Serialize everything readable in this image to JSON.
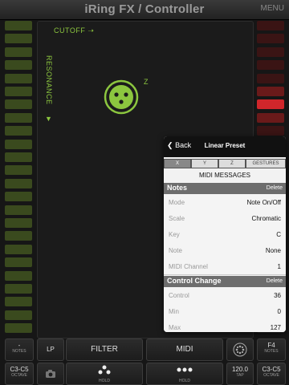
{
  "header": {
    "title": "iRing FX / Controller",
    "menu_label": "MENU"
  },
  "colors": {
    "accent": "#8cc63f",
    "meter_left": "#3a4a1e",
    "meter_right_dim": "#3a1414",
    "meter_right_active": "#d0262b"
  },
  "pad": {
    "x_axis_label": "CUTOFF",
    "y_axis_label": "RESONANCE",
    "z_label": "Z",
    "x_arrow_icon": "arrow-right-icon",
    "y_arrow_icon": "arrow-down-icon"
  },
  "popover": {
    "back_label": "Back",
    "title": "Linear Preset",
    "tabs": [
      "X",
      "Y",
      "Z",
      "GESTURES"
    ],
    "selected_tab": "X",
    "messages_header": "MIDI MESSAGES",
    "notes_section": {
      "title": "Notes",
      "delete_label": "Delete",
      "rows": [
        {
          "label": "Mode",
          "value": "Note On/Off"
        },
        {
          "label": "Scale",
          "value": "Chromatic"
        },
        {
          "label": "Key",
          "value": "C"
        },
        {
          "label": "Note",
          "value": "None"
        },
        {
          "label": "MIDI Channel",
          "value": "1"
        }
      ]
    },
    "cc_section": {
      "title": "Control Change",
      "delete_label": "Delete",
      "rows": [
        {
          "label": "Control",
          "value": "36"
        },
        {
          "label": "Min",
          "value": "0"
        },
        {
          "label": "Max",
          "value": "127"
        }
      ]
    }
  },
  "bottom": {
    "notes_left_value": "-",
    "notes_left_label": "NOTES",
    "lp_label": "LP",
    "filter_label": "FILTER",
    "midi_label": "MIDI",
    "notes_right_value": "F4",
    "notes_right_label": "NOTES",
    "octave_left_value": "C3-C5",
    "octave_left_label": "OCTAVE",
    "hold_left_label": "HOLD",
    "hold_right_label": "HOLD",
    "tap_value": "120.0",
    "tap_label": "TAP",
    "octave_right_value": "C3-C5",
    "octave_right_label": "OCTAVE"
  }
}
